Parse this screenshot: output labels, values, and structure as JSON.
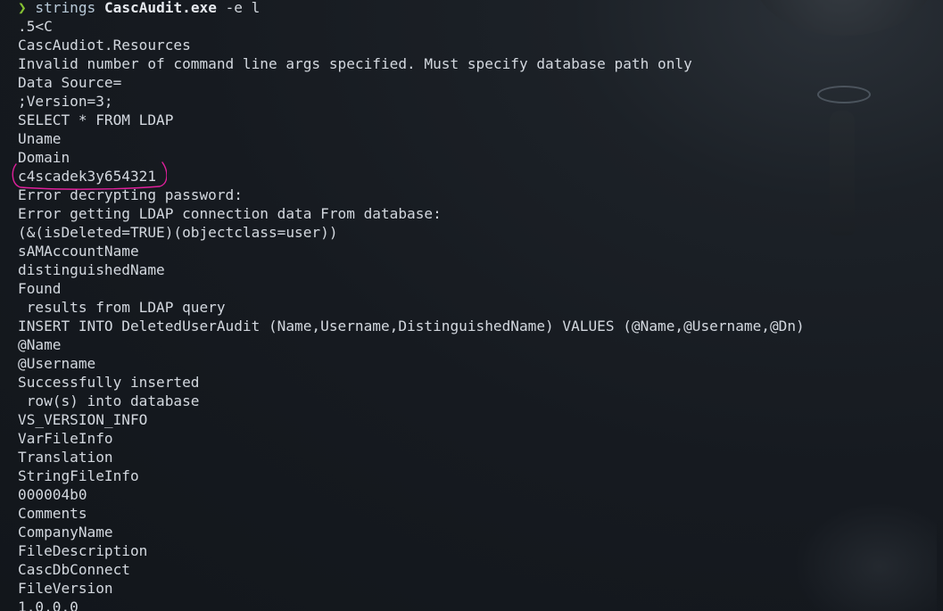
{
  "prompt": {
    "symbol": "❯",
    "command": "strings",
    "file": "CascAudit.exe",
    "flags": "-e l"
  },
  "output_lines": [
    ".5<C",
    "CascAudiot.Resources",
    "Invalid number of command line args specified. Must specify database path only",
    "Data Source=",
    ";Version=3;",
    "SELECT * FROM LDAP",
    "Uname",
    "Domain",
    "c4scadek3y654321",
    "Error decrypting password:",
    "Error getting LDAP connection data From database:",
    "(&(isDeleted=TRUE)(objectclass=user))",
    "sAMAccountName",
    "distinguishedName",
    "Found",
    " results from LDAP query",
    "INSERT INTO DeletedUserAudit (Name,Username,DistinguishedName) VALUES (@Name,@Username,@Dn)",
    "@Name",
    "@Username",
    "Successfully inserted",
    " row(s) into database",
    "VS_VERSION_INFO",
    "VarFileInfo",
    "Translation",
    "StringFileInfo",
    "000004b0",
    "Comments",
    "CompanyName",
    "FileDescription",
    "CascDbConnect",
    "FileVersion",
    "1.0.0.0"
  ],
  "colors": {
    "prompt_arrow": "#86c232",
    "text": "#d3d8df",
    "annotation": "#e0209c",
    "background": "#161a20"
  }
}
